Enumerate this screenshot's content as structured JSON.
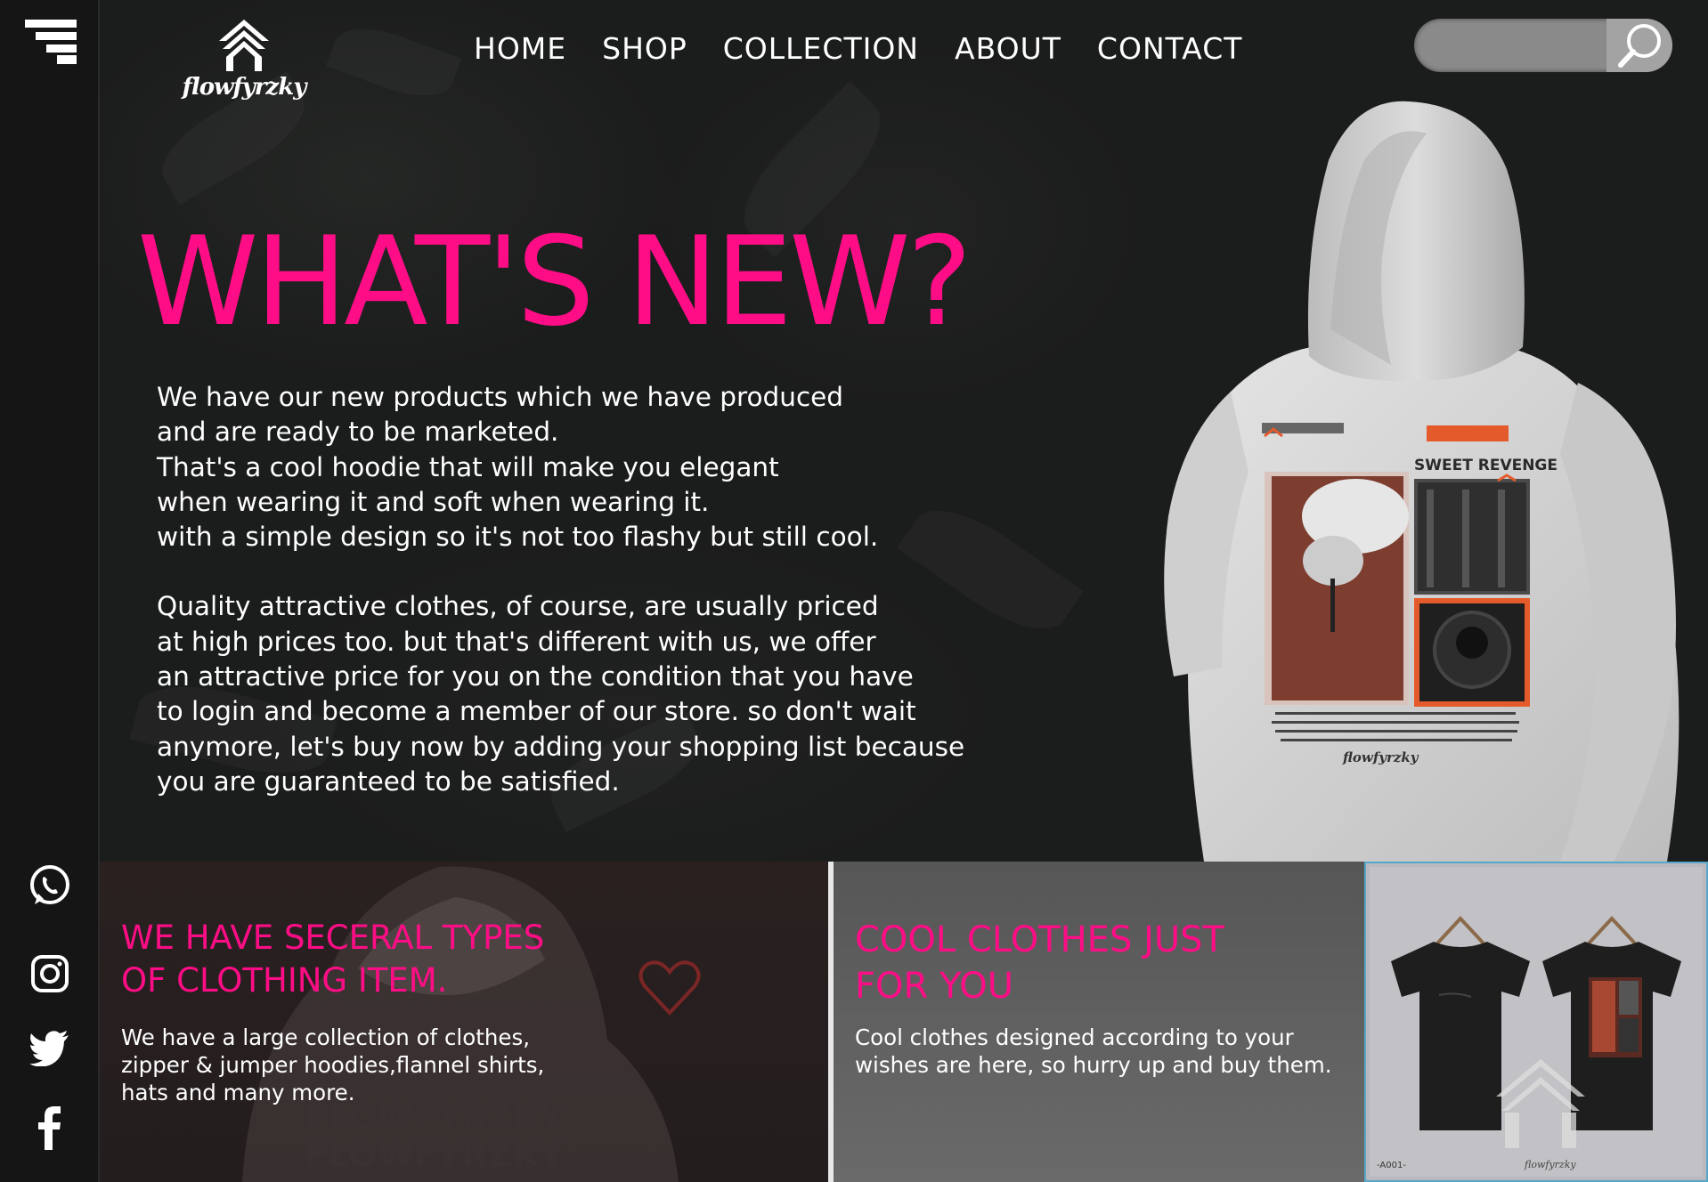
{
  "brand": {
    "logo_text": "flowfyrzky",
    "accent": "#ff0d86"
  },
  "sidebar": {
    "menu_icon": "menu-icon",
    "social": [
      {
        "name": "whatsapp-icon"
      },
      {
        "name": "instagram-icon"
      },
      {
        "name": "twitter-icon"
      },
      {
        "name": "facebook-icon"
      }
    ]
  },
  "nav": {
    "items": [
      "HOME",
      "SHOP",
      "COLLECTION",
      "ABOUT",
      "CONTACT"
    ]
  },
  "search": {
    "placeholder": "",
    "icon": "search-icon"
  },
  "hero": {
    "title": "WHAT'S NEW?",
    "paragraph1": [
      "We have our new products which we have produced",
      "and are ready to be marketed.",
      "That's a cool hoodie that will make you elegant",
      "when wearing it and soft when wearing it.",
      "with a simple design so it's not too flashy but still cool."
    ],
    "paragraph2": [
      "Quality attractive clothes, of course, are usually priced",
      "at high prices too. but that's different with us, we offer",
      "an attractive price for you on the condition that you have",
      "to login and become a member of our store. so don't wait",
      "anymore, let's buy now by adding your shopping list because",
      "you are guaranteed to be satisfied."
    ],
    "print_title": "SWEET REVENGE"
  },
  "panels": {
    "types": {
      "title_lines": [
        "WE HAVE SECERAL TYPES",
        "OF CLOTHING ITEM."
      ],
      "text_lines": [
        "We have a large collection of clothes,",
        "zipper & jumper hoodies,flannel shirts,",
        "hats and many more."
      ],
      "back_print": "FLOWFYRZKY"
    },
    "cool": {
      "title_lines": [
        "COOL CLOTHES JUST",
        "FOR YOU"
      ],
      "text_lines": [
        "Cool clothes designed according to your",
        "wishes are here, so hurry up and buy them."
      ]
    },
    "tshirt": {
      "code": "-A001-"
    }
  }
}
